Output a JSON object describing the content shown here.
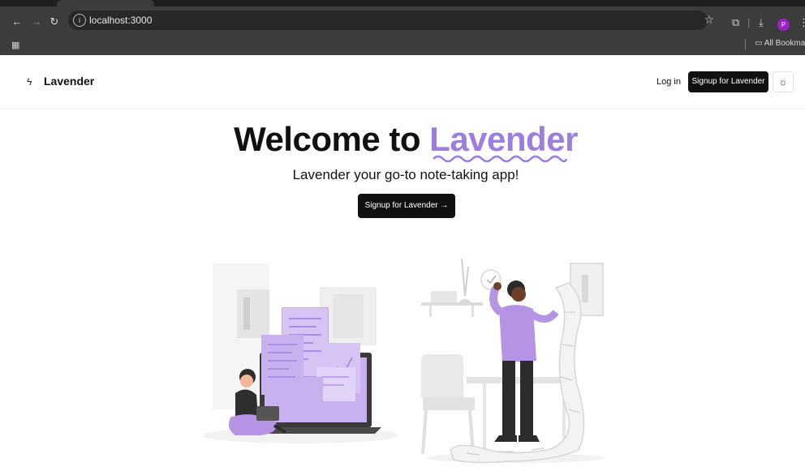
{
  "browser": {
    "url": "localhost:3000",
    "profile_initial": "P",
    "bookmarks_label": "All Bookmarks"
  },
  "header": {
    "brand": "Lavender",
    "login_label": "Log in",
    "signup_label": "Signup for Lavender"
  },
  "hero": {
    "title_prefix": "Welcome to",
    "title_brand": "Lavender",
    "subtitle": "Lavender your go-to note-taking app!",
    "cta_label": "Signup for Lavender",
    "cta_arrow": "→"
  },
  "colors": {
    "brand_purple": "#9b7ee0",
    "illustration_purple": "#b594e6",
    "button_dark": "#111111"
  },
  "icons": {
    "logo": "feather-icon",
    "theme": "sun-icon"
  }
}
